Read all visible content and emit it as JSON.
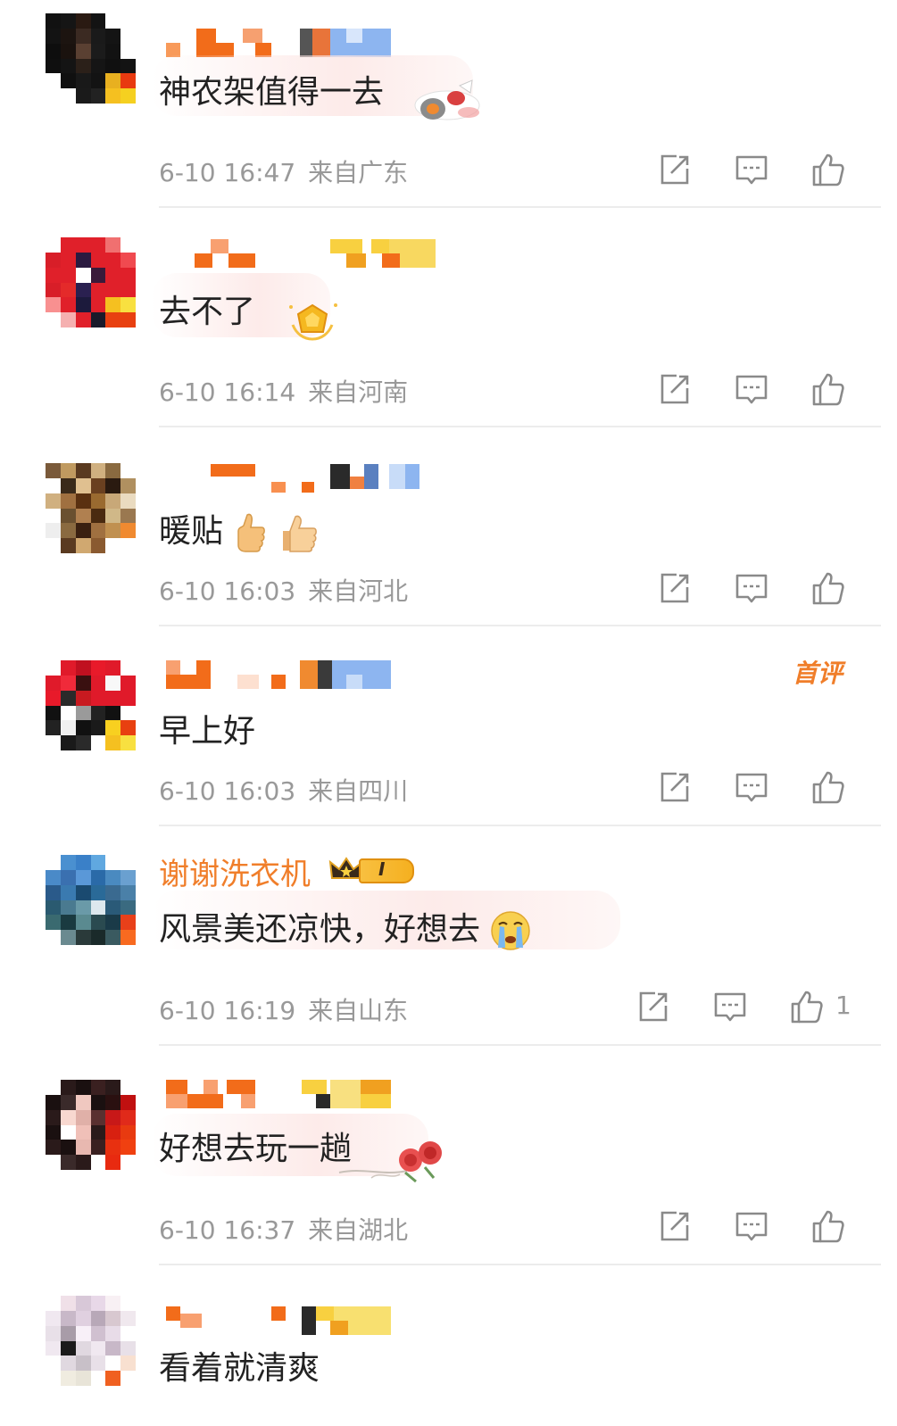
{
  "comments": [
    {
      "text": "神农架值得一去",
      "time": "6-10 16:47",
      "location": "来自广东",
      "likes": ""
    },
    {
      "text": "去不了",
      "time": "6-10 16:14",
      "location": "来自河南",
      "likes": ""
    },
    {
      "text": "暖贴",
      "time": "6-10 16:03",
      "location": "来自河北",
      "likes": ""
    },
    {
      "text": "早上好",
      "time": "6-10 16:03",
      "location": "来自四川",
      "likes": "",
      "badge": "首评"
    },
    {
      "username": "谢谢洗衣机",
      "level_badge": "I",
      "text": "风景美还凉快，好想去",
      "time": "6-10 16:19",
      "location": "来自山东",
      "likes": "1"
    },
    {
      "text": "好想去玩一趟",
      "time": "6-10 16:37",
      "location": "来自湖北",
      "likes": ""
    },
    {
      "text": "看着就清爽",
      "time": "",
      "location": "",
      "likes": ""
    }
  ],
  "icons": {
    "share": "share-icon",
    "reply": "comment-icon",
    "like": "thumbs-up-icon"
  },
  "colors": {
    "accent": "#f07e2a",
    "meta": "#999999",
    "text": "#222222"
  }
}
